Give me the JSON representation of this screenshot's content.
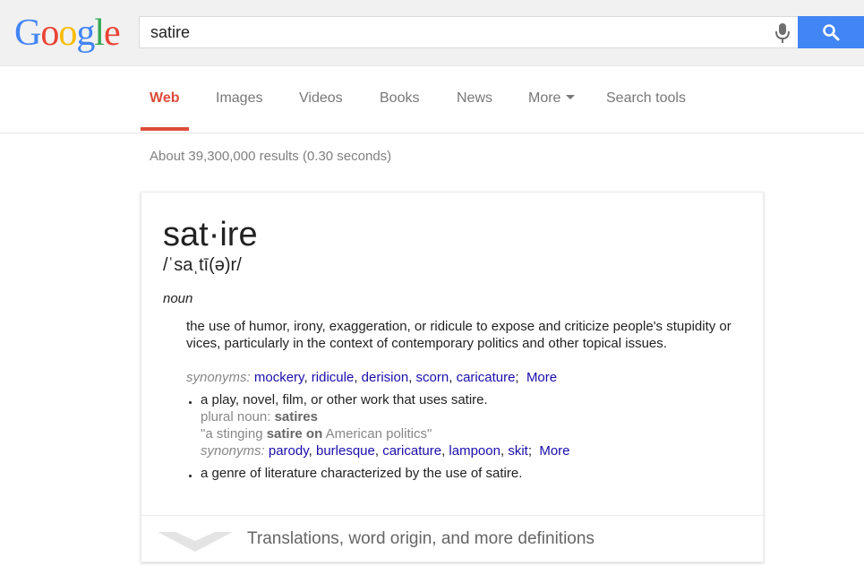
{
  "logo": {
    "letters": [
      "G",
      "o",
      "o",
      "g",
      "l",
      "e"
    ],
    "colors": [
      "#4285f4",
      "#ea4335",
      "#fbbc05",
      "#4285f4",
      "#34a853",
      "#ea4335"
    ]
  },
  "search": {
    "query": "satire"
  },
  "nav": {
    "web": "Web",
    "images": "Images",
    "videos": "Videos",
    "books": "Books",
    "news": "News",
    "more": "More",
    "tools": "Search tools"
  },
  "stats": "About 39,300,000 results (0.30 seconds)",
  "definition": {
    "word": "sat·ire",
    "phonetic": "/ˈsaˌtī(ə)r/",
    "part_of_speech": "noun",
    "sense1": "the use of humor, irony, exaggeration, or ridicule to expose and criticize people's stupidity or vices, particularly in the context of contemporary politics and other topical issues.",
    "synonyms_label": "synonyms:",
    "sense1_synonyms": [
      "mockery",
      "ridicule",
      "derision",
      "scorn",
      "caricature"
    ],
    "more_label": "More",
    "sense2": "a play, novel, film, or other work that uses satire.",
    "plural_label": "plural noun:",
    "plural_word": "satires",
    "example_open": "\"a stinging ",
    "example_bold": "satire on",
    "example_close": " American politics\"",
    "sense2_synonyms": [
      "parody",
      "burlesque",
      "caricature",
      "lampoon",
      "skit"
    ],
    "sense3": "a genre of literature characterized by the use of satire.",
    "footer": "Translations, word origin, and more definitions"
  }
}
